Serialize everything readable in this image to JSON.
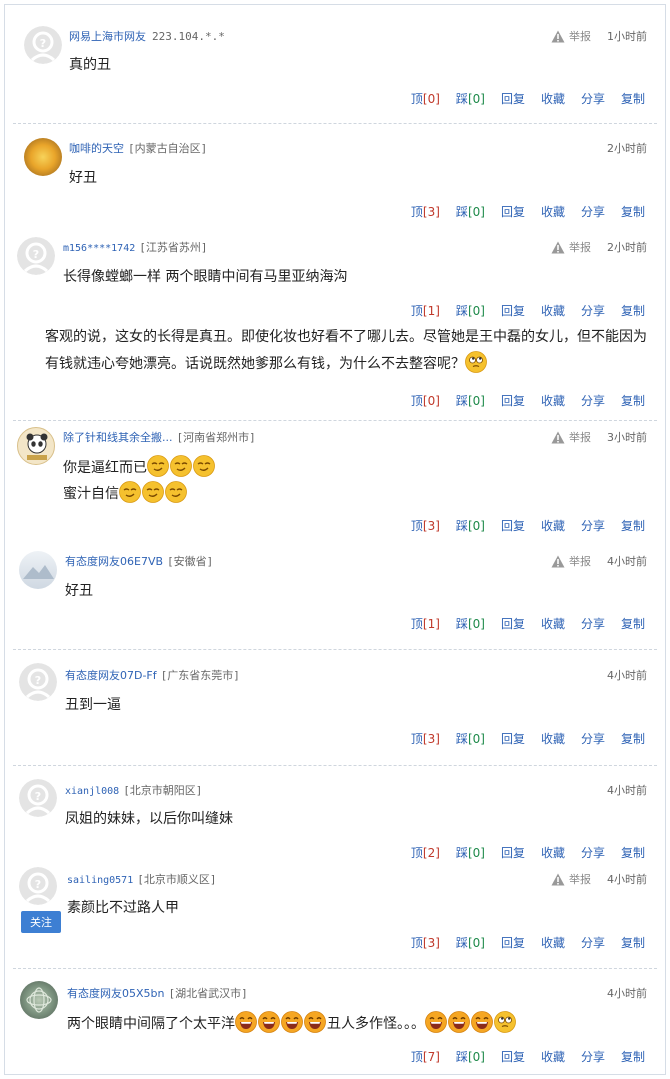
{
  "actions": {
    "up": "顶",
    "down": "踩",
    "reply": "回复",
    "favorite": "收藏",
    "share": "分享",
    "copy": "复制",
    "report": "举报"
  },
  "comments": [
    {
      "user": "网易上海市网友",
      "ip": "223.104.*.*",
      "time": "1小时前",
      "text": "真的丑",
      "up": "[0]",
      "down": "[0]"
    },
    {
      "user": "咖啡的天空",
      "loc": "[内蒙古自治区]",
      "time": "2小时前",
      "text": "好丑",
      "up": "[3]",
      "down": "[0]"
    },
    {
      "user": "m156****1742",
      "loc": "[江苏省苏州]",
      "time": "2小时前",
      "text": "长得像螳螂一样  两个眼睛中间有马里亚纳海沟",
      "up": "[1]",
      "down": "[0]"
    },
    {
      "text1": "客观的说，这女的长得是真丑。即使化妆也好看不了哪儿去。尽管她是王中磊的女儿，但不能因为",
      "text2": "有钱就违心夸她漂亮。话说既然她爹那么有钱，为什么不去整容呢？",
      "up": "[0]",
      "down": "[0]"
    },
    {
      "user": "除了针和线其余全搬...",
      "loc": "[河南省郑州市]",
      "time": "3小时前",
      "text1": "你是逼红而已",
      "text2": "蜜汁自信",
      "up": "[3]",
      "down": "[0]"
    },
    {
      "user": "有态度网友06E7VB",
      "loc": "[安徽省]",
      "time": "4小时前",
      "text": "好丑",
      "up": "[1]",
      "down": "[0]"
    },
    {
      "user": "有态度网友07D-Ff",
      "loc": "[广东省东莞市]",
      "time": "4小时前",
      "text": "丑到一逼",
      "up": "[3]",
      "down": "[0]"
    },
    {
      "user": "xianjl008",
      "loc": "[北京市朝阳区]",
      "time": "4小时前",
      "text": "凤姐的妹妹，以后你叫缝妹",
      "up": "[2]",
      "down": "[0]"
    },
    {
      "user": "sailing0571",
      "loc": "[北京市顺义区]",
      "time": "4小时前",
      "text": "素颜比不过路人甲",
      "up": "[3]",
      "down": "[0]",
      "follow": "关注"
    },
    {
      "user": "有态度网友05X5bn",
      "loc": "[湖北省武汉市]",
      "time": "4小时前",
      "text": "两个眼睛中间隔了个太平洋",
      "text_b": "丑人多作怪。。。",
      "up": "[7]",
      "down": "[0]"
    }
  ],
  "colors": {
    "link": "#2f63b5",
    "up_count": "#c0392b",
    "down_count": "#1e8a4a",
    "separator": "#cfd6de"
  }
}
